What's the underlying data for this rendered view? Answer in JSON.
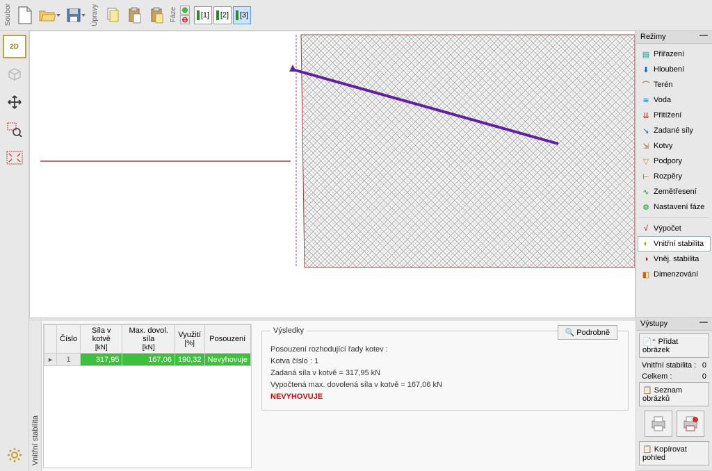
{
  "toolbar": {
    "file_label": "Soubor",
    "edit_label": "Úpravy",
    "phase_label": "Fáze",
    "phases": [
      "[1]",
      "[2]",
      "[3]"
    ],
    "active_phase": 2
  },
  "left_tools": {
    "view2d": "2D",
    "view3d": "3D"
  },
  "modes_panel": {
    "title": "Režimy",
    "items": [
      {
        "label": "Přiřazení",
        "icon": "assign"
      },
      {
        "label": "Hloubení",
        "icon": "excavation"
      },
      {
        "label": "Terén",
        "icon": "terrain"
      },
      {
        "label": "Voda",
        "icon": "water"
      },
      {
        "label": "Přitížení",
        "icon": "surcharge"
      },
      {
        "label": "Zadané síly",
        "icon": "forces"
      },
      {
        "label": "Kotvy",
        "icon": "anchors"
      },
      {
        "label": "Podpory",
        "icon": "supports"
      },
      {
        "label": "Rozpěry",
        "icon": "struts"
      },
      {
        "label": "Zemětřesení",
        "icon": "earthquake"
      },
      {
        "label": "Nastavení fáze",
        "icon": "phase-settings"
      }
    ],
    "calc_items": [
      {
        "label": "Výpočet",
        "icon": "calc"
      },
      {
        "label": "Vnitřní stabilita",
        "icon": "int-stability",
        "active": true
      },
      {
        "label": "Vněj. stabilita",
        "icon": "ext-stability"
      },
      {
        "label": "Dimenzování",
        "icon": "dimensioning"
      }
    ]
  },
  "outputs_panel": {
    "title": "Výstupy",
    "add_image": "Přidat obrázek",
    "int_stability_label": "Vnitřní stabilita :",
    "int_stability_count": "0",
    "total_label": "Celkem :",
    "total_count": "0",
    "image_list": "Seznam obrázků",
    "copy_view": "Kopírovat pohled"
  },
  "bottom_tab": "Vnitřní stabilita",
  "table": {
    "headers": {
      "num": "Číslo",
      "force": "Síla v kotvě",
      "force_unit": "[kN]",
      "max": "Max. dovol. síla",
      "max_unit": "[kN]",
      "util": "Využití",
      "util_unit": "[%]",
      "assess": "Posouzení"
    },
    "rows": [
      {
        "num": "1",
        "force": "317,95",
        "max": "167,06",
        "util": "190,32",
        "assess": "Nevyhovuje"
      }
    ]
  },
  "results": {
    "title": "Výsledky",
    "detail_btn": "Podrobně",
    "line1": "Posouzení rozhodující řady kotev :",
    "line2": "Kotva číslo : 1",
    "line3": "Zadaná síla v kotvě = 317,95 kN",
    "line4": "Vypočtená max. dovolená síla v kotvě = 167,06 kN",
    "fail": "NEVYHOVUJE"
  }
}
